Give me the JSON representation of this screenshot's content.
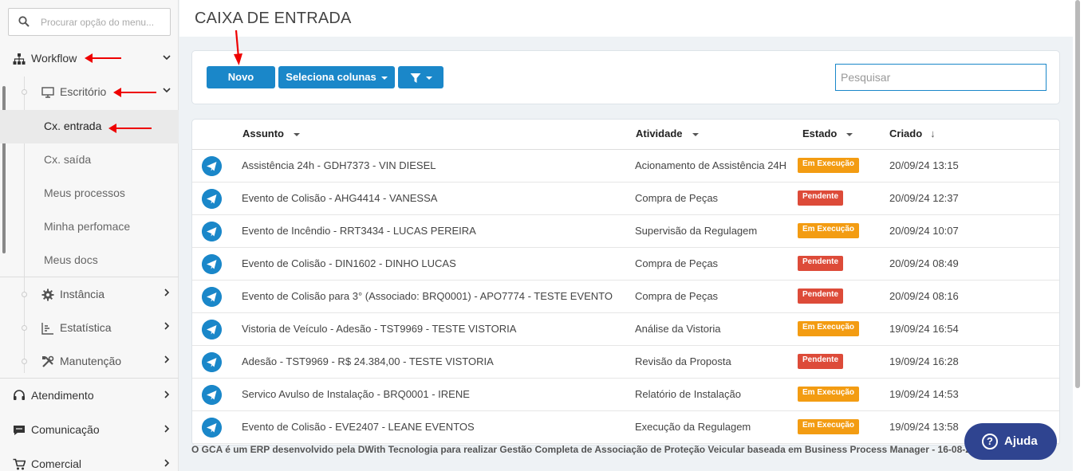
{
  "colors": {
    "accent": "#1a87c9",
    "execucao": "#f39c12",
    "pendente": "#dd4b39",
    "help": "#2f4490"
  },
  "sidebar": {
    "search_placeholder": "Procurar opção do menu...",
    "workflow": "Workflow",
    "escritorio": "Escritório",
    "cx_entrada": "Cx. entrada",
    "cx_saida": "Cx. saída",
    "meus_processos": "Meus processos",
    "minha_performace": "Minha perfomace",
    "meus_docs": "Meus docs",
    "instancia": "Instância",
    "estatistica": "Estatística",
    "manutencao": "Manutenção",
    "atendimento": "Atendimento",
    "comunicacao": "Comunicação",
    "comercial": "Comercial"
  },
  "page": {
    "title": "CAIXA DE ENTRADA"
  },
  "toolbar": {
    "novo": "Novo",
    "seleciona_colunas": "Seleciona colunas",
    "search_placeholder": "Pesquisar"
  },
  "table": {
    "headers": {
      "assunto": "Assunto",
      "atividade": "Atividade",
      "estado": "Estado",
      "criado": "Criado"
    },
    "rows": [
      {
        "assunto": "Assistência 24h - GDH7373 - VIN DIESEL",
        "atividade": "Acionamento de Assistência 24H",
        "estado": "Em Execução",
        "criado": "20/09/24 13:15"
      },
      {
        "assunto": "Evento de Colisão - AHG4414 - VANESSA",
        "atividade": "Compra de Peças",
        "estado": "Pendente",
        "criado": "20/09/24 12:37"
      },
      {
        "assunto": "Evento de Incêndio - RRT3434 - LUCAS PEREIRA",
        "atividade": "Supervisão da Regulagem",
        "estado": "Em Execução",
        "criado": "20/09/24 10:07"
      },
      {
        "assunto": "Evento de Colisão - DIN1602 - DINHO LUCAS",
        "atividade": "Compra de Peças",
        "estado": "Pendente",
        "criado": "20/09/24 08:49"
      },
      {
        "assunto": "Evento de Colisão para 3° (Associado: BRQ0001) - APO7774 - TESTE EVENTO",
        "atividade": "Compra de Peças",
        "estado": "Pendente",
        "criado": "20/09/24 08:16"
      },
      {
        "assunto": "Vistoria de Veículo - Adesão - TST9969 - TESTE VISTORIA",
        "atividade": "Análise da Vistoria",
        "estado": "Em Execução",
        "criado": "19/09/24 16:54"
      },
      {
        "assunto": "Adesão - TST9969 - R$ 24.384,00 - TESTE VISTORIA",
        "atividade": "Revisão da Proposta",
        "estado": "Pendente",
        "criado": "19/09/24 16:28"
      },
      {
        "assunto": "Servico Avulso de Instalação - BRQ0001 - IRENE",
        "atividade": "Relatório de Instalação",
        "estado": "Em Execução",
        "criado": "19/09/24 14:53"
      },
      {
        "assunto": "Evento de Colisão - EVE2407 - LEANE EVENTOS",
        "atividade": "Execução da Regulagem",
        "estado": "Em Execução",
        "criado": "19/09/24 13:58"
      }
    ]
  },
  "footer": {
    "text": "O GCA é um ERP desenvolvido pela DWith Tecnologia para realizar Gestão Completa de Associação de Proteção Veicular baseada em Business Process Manager - 16-08-2024 - Build 230"
  },
  "help": {
    "label": "Ajuda"
  }
}
